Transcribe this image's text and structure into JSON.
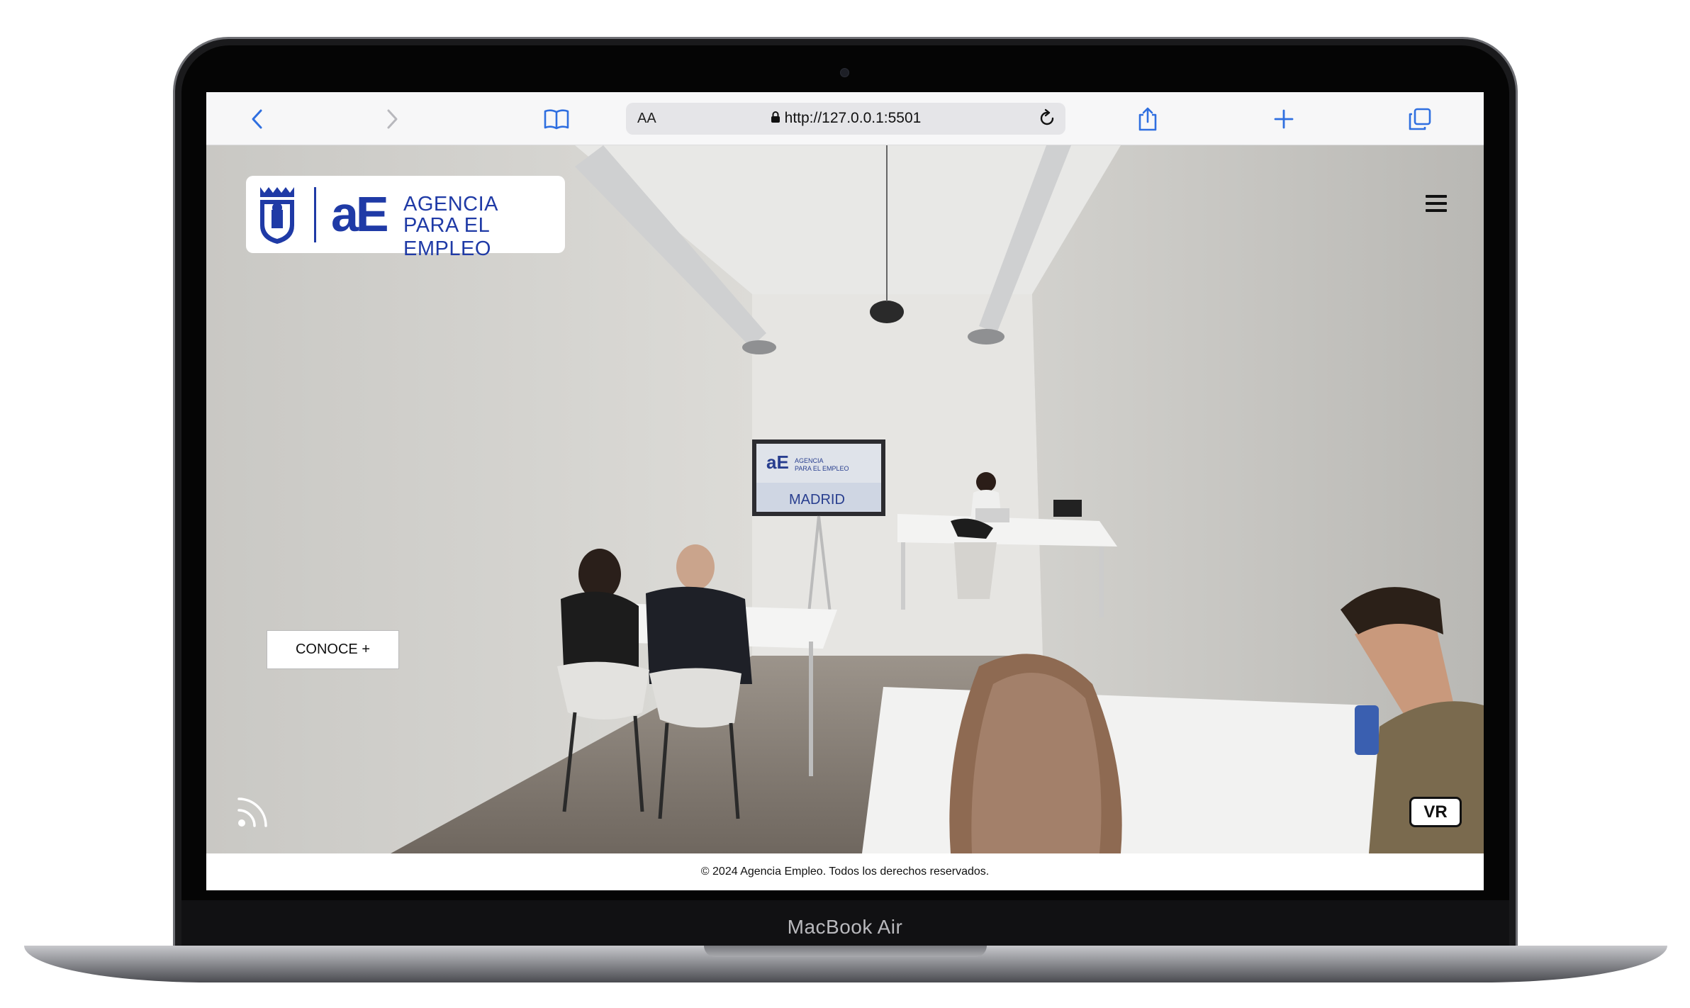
{
  "device": {
    "model_label": "MacBook Air"
  },
  "browser": {
    "text_size_label": "AA",
    "url": "http://127.0.0.1:5501",
    "icons": [
      "back-icon",
      "forward-icon",
      "bookmarks-icon",
      "lock-icon",
      "reload-icon",
      "share-icon",
      "new-tab-icon",
      "tabs-icon"
    ]
  },
  "page": {
    "logo": {
      "mark": "aE",
      "line1": "AGENCIA",
      "line2": "PARA EL EMPLEO"
    },
    "conoce_button": "CONOCE +",
    "vr_button": "VR",
    "footer": "© 2024 Agencia Empleo. Todos los derechos reservados.",
    "scene_screen": {
      "mark": "aE",
      "line1": "AGENCIA",
      "line2": "PARA EL EMPLEO",
      "city": "MADRID"
    }
  },
  "colors": {
    "brand_blue": "#1f3aa6",
    "browser_accent": "#2f6fe0"
  }
}
